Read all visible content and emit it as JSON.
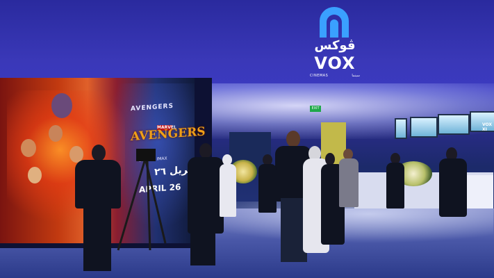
{
  "scene": {
    "description_colors": {
      "wall": "#3b3ac0",
      "floor": "#4a58a8",
      "logo": "#ffffff",
      "poster_accent": "#f0a018"
    }
  },
  "logo": {
    "arabic_name": "ڤوكس",
    "name": "VOX",
    "sub_left": "CINEMAS",
    "sub_right": "سينما",
    "icon": "vox-arch-icon"
  },
  "poster": {
    "heading": "AVENGERS",
    "brand": "MARVEL",
    "title": "AVENGERS",
    "format": "2D AND IMAX",
    "date_ar": "ابريل ٢٦",
    "date_en": "APRIL 26"
  },
  "signage": {
    "exit": "EXIT",
    "screen_label": "VOX XI"
  }
}
